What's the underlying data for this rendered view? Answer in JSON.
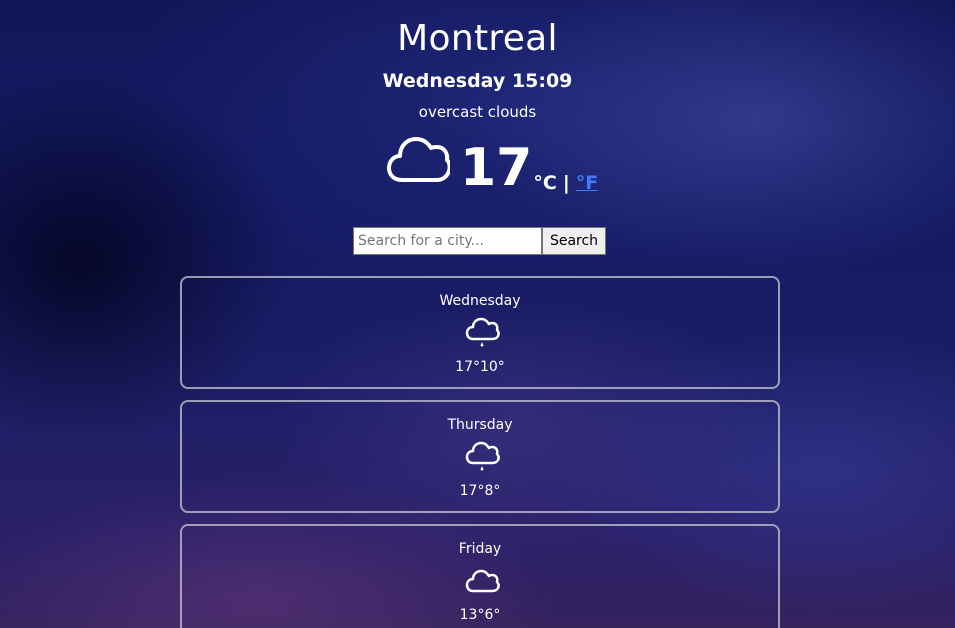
{
  "location": {
    "city": "Montreal",
    "datetime": "Wednesday 15:09",
    "description": "overcast clouds"
  },
  "current": {
    "icon": "cloud-icon",
    "temperature": "17",
    "unit_celsius": "°C",
    "unit_separator": "|",
    "unit_fahrenheit": "°F",
    "link_color": "#3d7bff"
  },
  "search": {
    "placeholder": "Search for a city...",
    "value": "",
    "button_label": "Search"
  },
  "forecast": [
    {
      "day": "Wednesday",
      "icon": "cloud-rain-icon",
      "temps": "17°10°"
    },
    {
      "day": "Thursday",
      "icon": "cloud-rain-icon",
      "temps": "17°8°"
    },
    {
      "day": "Friday",
      "icon": "cloud-icon",
      "temps": "13°6°"
    }
  ]
}
